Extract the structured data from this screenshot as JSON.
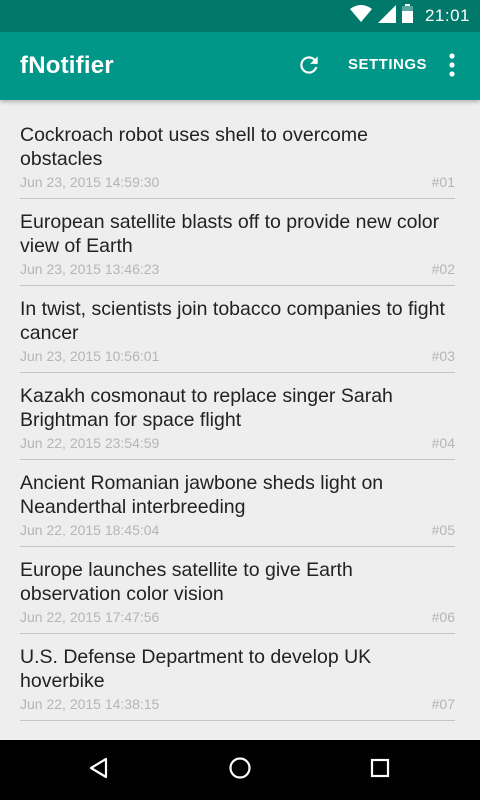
{
  "status_bar": {
    "time": "21:01",
    "icons": [
      "wifi-icon",
      "signal-icon",
      "battery-icon"
    ]
  },
  "app_bar": {
    "title": "fNotifier",
    "refresh_icon": "refresh-icon",
    "settings_label": "SETTINGS",
    "overflow_icon": "more-vert-icon"
  },
  "news": [
    {
      "title": "Cockroach robot uses shell to overcome obstacles",
      "date": "Jun 23, 2015 14:59:30",
      "num": "#01"
    },
    {
      "title": "European satellite blasts off to provide new color view of Earth",
      "date": "Jun 23, 2015 13:46:23",
      "num": "#02"
    },
    {
      "title": "In twist, scientists join tobacco companies to fight cancer",
      "date": "Jun 23, 2015 10:56:01",
      "num": "#03"
    },
    {
      "title": "Kazakh cosmonaut to replace singer Sarah Brightman for space flight",
      "date": "Jun 22, 2015 23:54:59",
      "num": "#04"
    },
    {
      "title": "Ancient Romanian jawbone sheds light on Neanderthal interbreeding",
      "date": "Jun 22, 2015 18:45:04",
      "num": "#05"
    },
    {
      "title": "Europe launches satellite to give Earth observation color vision",
      "date": "Jun 22, 2015 17:47:56",
      "num": "#06"
    },
    {
      "title": "U.S. Defense Department to develop UK hoverbike",
      "date": "Jun 22, 2015 14:38:15",
      "num": "#07"
    }
  ],
  "nav_bar": {
    "back_icon": "back-icon",
    "home_icon": "home-icon",
    "recents_icon": "recents-icon"
  },
  "colors": {
    "status_bar": "#00796b",
    "app_bar": "#009688",
    "background": "#eeeeee"
  }
}
